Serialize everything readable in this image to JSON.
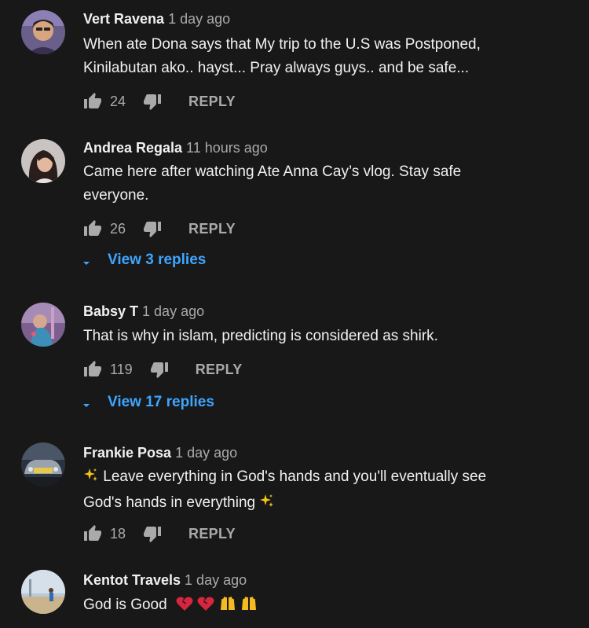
{
  "comments": [
    {
      "author": "Vert Ravena",
      "time": "1 day ago",
      "text_lines": [
        "When ate Dona says that My trip to the U.S was Postponed,",
        "Kinilabutan ako.. hayst...  Pray always guys.. and be safe..."
      ],
      "likes": "24",
      "reply_label": "REPLY"
    },
    {
      "author": "Andrea Regala",
      "time": "11 hours ago",
      "text_lines": [
        "Came here after watching Ate Anna Cay’s vlog. Stay safe",
        "everyone."
      ],
      "likes": "26",
      "reply_label": "REPLY",
      "view_replies": "View 3 replies"
    },
    {
      "author": "Babsy T",
      "time": "1 day ago",
      "text_lines": [
        "That is why in islam, predicting is considered as shirk."
      ],
      "likes": "119",
      "reply_label": "REPLY",
      "view_replies": "View 17 replies"
    },
    {
      "author": "Frankie Posa",
      "time": "1 day ago",
      "text_lines": [
        "Leave everything in God's hands and you'll eventually see",
        "God's hands in everything"
      ],
      "likes": "18",
      "reply_label": "REPLY"
    },
    {
      "author": "Kentot Travels",
      "time": "1 day ago",
      "text_lines": [
        "God is Good"
      ]
    }
  ],
  "icons": {
    "like": "thumb-up-icon",
    "dislike": "thumb-down-icon",
    "expand": "caret-down-icon",
    "sparkles": "sparkles-emoji",
    "broken_heart": "broken-heart-emoji",
    "raised_hands": "raised-hands-emoji"
  },
  "colors": {
    "background": "#181818",
    "primary_text": "#f1f1f1",
    "secondary_text": "#aaaaaa",
    "link_blue": "#3ea6ff"
  }
}
